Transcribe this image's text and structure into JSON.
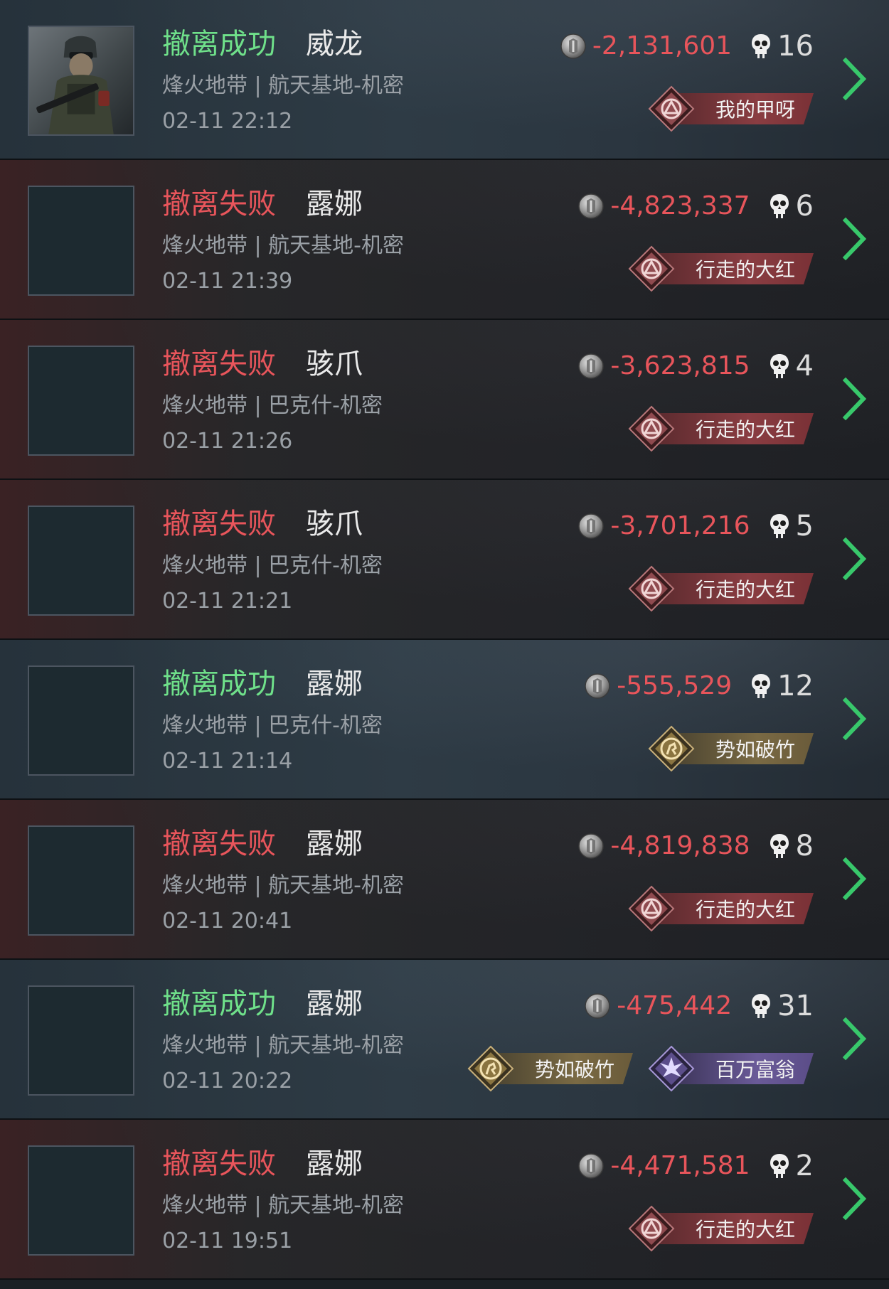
{
  "colors": {
    "success": "#6fe08a",
    "fail": "#e8555b",
    "value": "#e8555b",
    "chevron": "#38c86b"
  },
  "records": [
    {
      "result": "success",
      "status": "撤离成功",
      "operator": "威龙",
      "map": "烽火地带 | 航天基地-机密",
      "time": "02-11 22:12",
      "value": "-2,131,601",
      "kills": "16",
      "has_portrait": true,
      "badges": [
        {
          "label": "我的甲呀",
          "style": "red"
        }
      ]
    },
    {
      "result": "fail",
      "status": "撤离失败",
      "operator": "露娜",
      "map": "烽火地带 | 航天基地-机密",
      "time": "02-11 21:39",
      "value": "-4,823,337",
      "kills": "6",
      "has_portrait": false,
      "badges": [
        {
          "label": "行走的大红",
          "style": "red"
        }
      ]
    },
    {
      "result": "fail",
      "status": "撤离失败",
      "operator": "骇爪",
      "map": "烽火地带 | 巴克什-机密",
      "time": "02-11 21:26",
      "value": "-3,623,815",
      "kills": "4",
      "has_portrait": false,
      "badges": [
        {
          "label": "行走的大红",
          "style": "red"
        }
      ]
    },
    {
      "result": "fail",
      "status": "撤离失败",
      "operator": "骇爪",
      "map": "烽火地带 | 巴克什-机密",
      "time": "02-11 21:21",
      "value": "-3,701,216",
      "kills": "5",
      "has_portrait": false,
      "badges": [
        {
          "label": "行走的大红",
          "style": "red"
        }
      ]
    },
    {
      "result": "success",
      "status": "撤离成功",
      "operator": "露娜",
      "map": "烽火地带 | 巴克什-机密",
      "time": "02-11 21:14",
      "value": "-555,529",
      "kills": "12",
      "has_portrait": false,
      "badges": [
        {
          "label": "势如破竹",
          "style": "gold"
        }
      ]
    },
    {
      "result": "fail",
      "status": "撤离失败",
      "operator": "露娜",
      "map": "烽火地带 | 航天基地-机密",
      "time": "02-11 20:41",
      "value": "-4,819,838",
      "kills": "8",
      "has_portrait": false,
      "badges": [
        {
          "label": "行走的大红",
          "style": "red"
        }
      ]
    },
    {
      "result": "success",
      "status": "撤离成功",
      "operator": "露娜",
      "map": "烽火地带 | 航天基地-机密",
      "time": "02-11 20:22",
      "value": "-475,442",
      "kills": "31",
      "has_portrait": false,
      "badges": [
        {
          "label": "势如破竹",
          "style": "gold"
        },
        {
          "label": "百万富翁",
          "style": "purple"
        }
      ]
    },
    {
      "result": "fail",
      "status": "撤离失败",
      "operator": "露娜",
      "map": "烽火地带 | 航天基地-机密",
      "time": "02-11 19:51",
      "value": "-4,471,581",
      "kills": "2",
      "has_portrait": false,
      "badges": [
        {
          "label": "行走的大红",
          "style": "red"
        }
      ]
    }
  ]
}
